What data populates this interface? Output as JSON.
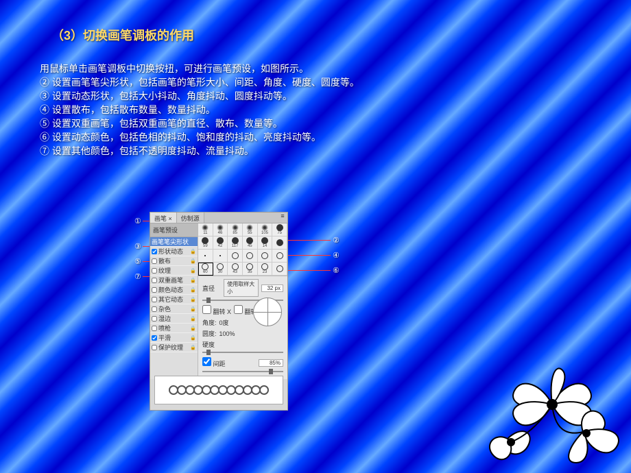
{
  "heading": "（3）切换画笔调板的作用",
  "body": {
    "l1": "用鼠标单击画笔调板中切换按扭，可进行画笔预设，如图所示。",
    "l2": "② 设置画笔笔尖形状，包括画笔的笔形大小、间距、角度、硬度、圆度等。",
    "l3": "③ 设置动态形状，包括大小抖动、角度抖动、圆度抖动等。",
    "l4": "④ 设置散布，包括散布数量、数量抖动。",
    "l5": "⑤ 设置双重画笔，包括双重画笔的直径、散布、数量等。",
    "l6": "⑥ 设置动态颜色，包括色相的抖动、饱和度的抖动、亮度抖动等。",
    "l7": "⑦ 设置其他颜色，包括不透明度抖动、流量抖动。"
  },
  "panel": {
    "tab_brush": "画笔 ×",
    "tab_clone": "仿制源",
    "options_header": "画笔预设",
    "opts": {
      "tip": "画笔笔尖形状",
      "shape_dyn": "形状动态",
      "scatter": "散布",
      "texture": "纹理",
      "dual": "双重画笔",
      "color_dyn": "颜色动态",
      "other_dyn": "其它动态",
      "noise": "杂色",
      "wet": "湿边",
      "airbrush": "喷枪",
      "smoothing": "平滑",
      "protect": "保护纹理"
    },
    "brush_sizes": [
      "11",
      "46",
      "85",
      "55",
      "105",
      "75",
      "59",
      "42",
      "117",
      "45",
      "14",
      "",
      "",
      "",
      "",
      "",
      "",
      "",
      "60",
      "30",
      "43",
      "35",
      "23",
      ""
    ],
    "diameter_label": "直径",
    "diameter_btn": "使用取样大小",
    "diameter_val": "32 px",
    "flip_x": "翻转 X",
    "flip_y": "翻转 Y",
    "angle_label": "角度:",
    "angle_val": "0度",
    "roundness_label": "圆度:",
    "roundness_val": "100%",
    "hardness_label": "硬度",
    "spacing_label": "间距",
    "spacing_val": "85%"
  },
  "callouts": {
    "c1": "①",
    "c2": "②",
    "c3": "③",
    "c4": "④",
    "c5": "⑤",
    "c6": "⑥",
    "c7": "⑦"
  }
}
